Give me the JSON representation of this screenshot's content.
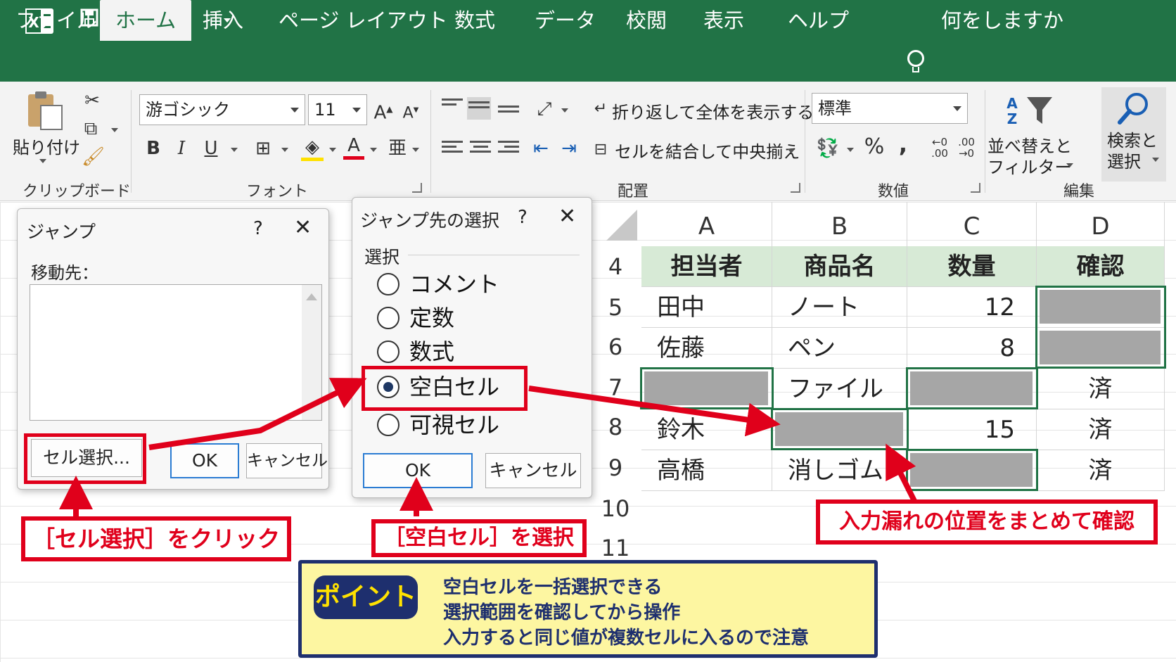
{
  "quick_access": {
    "save_icon": "save-icon",
    "undo_icon": "undo-icon",
    "redo_icon": "redo-icon",
    "customize_icon": "customize-qat-icon"
  },
  "tabs": [
    "ファイル",
    "ホーム",
    "挿入",
    "ページ レイアウト",
    "数式",
    "データ",
    "校閲",
    "表示",
    "ヘルプ"
  ],
  "active_tab": "ホーム",
  "tell_me": "何をしますか",
  "ribbon": {
    "clipboard": {
      "paste": "貼り付け",
      "group": "クリップボード"
    },
    "font": {
      "name": "游ゴシック",
      "size": "11",
      "bold": "B",
      "italic": "I",
      "underline": "U",
      "grow": "A",
      "shrink": "A",
      "color": "A",
      "group": "フォント"
    },
    "alignment": {
      "wrap": "折り返して全体を表示する",
      "merge": "セルを結合して中央揃え",
      "group": "配置"
    },
    "number": {
      "format": "標準",
      "percent": "%",
      "comma": ",",
      "inc_decimal": ".00",
      "dec_decimal": ".00",
      "group": "数値"
    },
    "editing": {
      "sort_filter": "並べ替えと",
      "sort_filter2": "フィルター",
      "find_select": "検索と",
      "find_select2": "選択",
      "group": "編集"
    }
  },
  "goto_dialog": {
    "title": "ジャンプ",
    "help": "?",
    "close": "✕",
    "reference_label": "移動先：",
    "special_button": "セル選択...",
    "ok": "OK",
    "cancel": "キャンセル"
  },
  "goto_special_dialog": {
    "title": "ジャンプ先の選択",
    "help": "?",
    "close": "✕",
    "group_label": "選択",
    "options": [
      "コメント",
      "定数",
      "数式",
      "空白セル",
      "可視セル"
    ],
    "selected": "空白セル",
    "ok": "OK",
    "cancel": "キャンセル"
  },
  "sheet": {
    "columns": [
      "A",
      "B",
      "C",
      "D"
    ],
    "row_numbers": [
      "4",
      "5",
      "6",
      "7",
      "8",
      "9",
      "10",
      "11"
    ],
    "header": [
      "担当者",
      "商品名",
      "数量",
      "確認"
    ],
    "rows": [
      [
        "田中",
        "ノート",
        "12",
        ""
      ],
      [
        "佐藤",
        "ペン",
        "8",
        ""
      ],
      [
        "",
        "ファイル",
        "",
        "済"
      ],
      [
        "鈴木",
        "",
        "15",
        "済"
      ],
      [
        "高橋",
        "消しゴム",
        "",
        "済"
      ]
    ]
  },
  "callouts": {
    "click_special": "［セル選択］をクリック",
    "select_blanks": "［空白セル］を選択",
    "confirm": "入力漏れの位置をまとめて確認"
  },
  "point": {
    "badge": "ポイント",
    "lines": [
      "空白セルを一括選択できる",
      "選択範囲を確認してから操作",
      "入力すると同じ値が複数セルに入るので注意"
    ]
  },
  "colors": {
    "excel_green": "#217346",
    "header_fill": "#d7ead6",
    "blank_fill": "#a6a6a6",
    "highlight_red": "#e0001b",
    "point_bg": "#fdf6a1",
    "point_navy": "#1e2f6e"
  }
}
